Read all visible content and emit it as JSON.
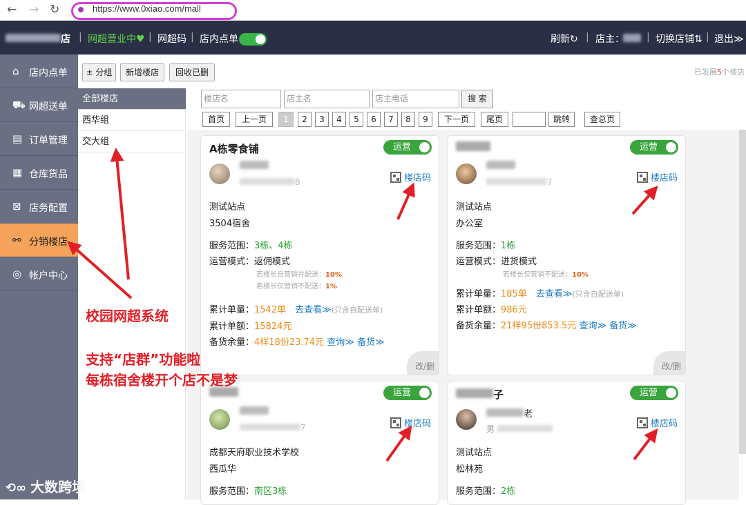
{
  "browser": {
    "url": "https://www.0xiao.com/mall"
  },
  "header": {
    "shop_suffix": "店",
    "status": "网超营业中♥",
    "qr": "网超码",
    "in_store": "店内点单",
    "refresh": "刷新↻",
    "owner_label": "店主：",
    "switch": "切换店铺⇅",
    "logout": "退出≫"
  },
  "sidebar": {
    "items": [
      {
        "icon": "⌂",
        "label": "店内点单"
      },
      {
        "icon": "⛟",
        "label": "网超送单"
      },
      {
        "icon": "▤",
        "label": "订单管理"
      },
      {
        "icon": "▦",
        "label": "仓库货品"
      },
      {
        "icon": "⊠",
        "label": "店务配置"
      },
      {
        "icon": "⚯",
        "label": "分销楼店"
      },
      {
        "icon": "◎",
        "label": "帐户中心"
      }
    ]
  },
  "toolbar": {
    "group_btn": "± 分组",
    "add_btn": "新增楼店",
    "recycle_btn": "回收已删",
    "stat_pre": "已发展",
    "stat_num": "5",
    "stat_post": "个楼店"
  },
  "groups": [
    "全部楼店",
    "西华组",
    "交大组"
  ],
  "search": {
    "store_ph": "楼店名",
    "owner_ph": "店主名",
    "phone_ph": "店主电话",
    "btn": "搜 索"
  },
  "pager": {
    "first": "首页",
    "prev": "上一页",
    "pages": [
      "1",
      "2",
      "3",
      "4",
      "5",
      "6",
      "7",
      "8",
      "9"
    ],
    "next": "下一页",
    "last": "尾页",
    "jump": "跳转",
    "total": "查总页"
  },
  "cards": [
    {
      "title": "A栋零食铺",
      "run": "运营",
      "name_tail": "",
      "phone_tail": "8",
      "qr": "楼店码",
      "site": "测试站点",
      "addr": "3504宿舍",
      "scope_label": "服务范围：",
      "scope": "3栋、4栋",
      "mode_label": "运营模式：",
      "mode": "返佣模式",
      "sub1_label": "若楼长自营销并配送：",
      "sub1": "10%",
      "sub2_label": "若楼长仅营销不配送：",
      "sub2": "1%",
      "orders_label": "累计单量：",
      "orders": "1542单",
      "view": "去查看≫",
      "view_note": "(只含自配送单)",
      "amount_label": "累计单额：",
      "amount": "15824元",
      "stock_label": "备货余量：",
      "stock": "4样18份23.74元",
      "query": "查询≫",
      "stock_btn": "备货≫",
      "edit": "改/删"
    },
    {
      "title": "",
      "run": "运营",
      "name_tail": "",
      "phone_tail": "7",
      "qr": "楼店码",
      "site": "测试站点",
      "addr": "办公室",
      "scope_label": "服务范围：",
      "scope": "1栋",
      "mode_label": "运营模式：",
      "mode": "进货模式",
      "sub1_label": "若楼长仅营销不配送：",
      "sub1": "10%",
      "orders_label": "累计单量：",
      "orders": "185单",
      "view": "去查看≫",
      "view_note": "(只含自配送单)",
      "amount_label": "累计单额：",
      "amount": "986元",
      "stock_label": "备货余量：",
      "stock": "21样95份853.5元",
      "query": "查询≫",
      "stock_btn": "备货≫",
      "edit": "改/删"
    },
    {
      "title": "",
      "title_tail": "",
      "run": "运营",
      "phone_tail": "7",
      "qr": "楼店码",
      "site": "成都天府职业技术学校",
      "addr": "西瓜华",
      "scope_label": "服务范围：",
      "scope": "南区3栋"
    },
    {
      "title": "",
      "title_tail": "子",
      "run": "运营",
      "name_tail": "老",
      "phone_head": "男",
      "qr": "楼店码",
      "site": "测试站点",
      "addr": "松林苑",
      "scope_label": "服务范围：",
      "scope": "2栋"
    }
  ],
  "annotations": {
    "system": "校园网超系统",
    "line1": "支持“店群”功能啦",
    "line2": "每栋宿舍楼开个店不是梦"
  },
  "watermark": "大数跨境",
  "colors": {
    "header": "#2b2f45",
    "sidebar": "#6b6f84",
    "active": "#f5a35b",
    "green": "#3aa53d",
    "annotation": "#e21f26"
  }
}
